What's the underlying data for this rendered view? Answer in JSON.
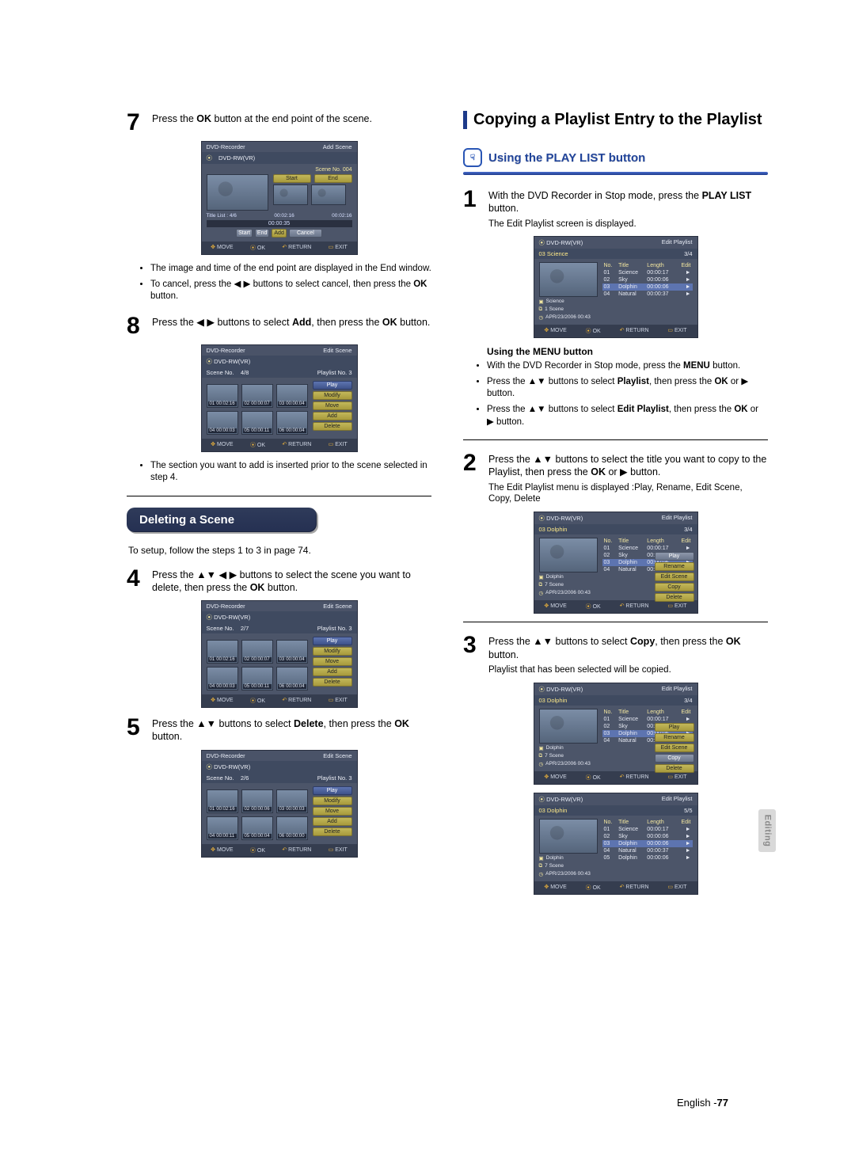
{
  "sideTab": "Editing",
  "footer": {
    "lang": "English -",
    "page": "77"
  },
  "left": {
    "step7": {
      "num": "7",
      "text_a": "Press the ",
      "text_b": "OK",
      "text_c": " button at the end point of the scene."
    },
    "step7_bullets": [
      "The image and time of the end point are displayed in the End window.",
      [
        "To cancel, press the ",
        "◀ ▶",
        " buttons to select cancel, then press the ",
        "OK",
        " button."
      ]
    ],
    "step8": {
      "num": "8",
      "parts": [
        "Press the ",
        "◀ ▶",
        " buttons to select ",
        "Add",
        ", then press the ",
        "OK",
        " button."
      ]
    },
    "step8_bullets": [
      "The section you want to add is inserted prior to the scene selected in step 4."
    ],
    "deleteTitle": "Deleting a Scene",
    "deleteIntro": "To setup, follow the steps 1 to 3 in page 74.",
    "step4": {
      "num": "4",
      "parts": [
        "Press the ",
        "▲▼ ◀ ▶",
        " buttons to select the scene you want to delete, then press the ",
        "OK",
        " button."
      ]
    },
    "step5": {
      "num": "5",
      "parts": [
        "Press the ",
        "▲▼",
        " buttons to select ",
        "Delete",
        ", then press the ",
        "OK",
        " button."
      ]
    }
  },
  "right": {
    "h1": "Copying a Playlist Entry to the Playlist",
    "h2": "Using the PLAY LIST button",
    "step1": {
      "num": "1",
      "parts": [
        "With the DVD Recorder in Stop mode, press the ",
        "PLAY LIST",
        " button."
      ],
      "small": "The Edit Playlist screen is displayed."
    },
    "menuTitle": "Using the MENU button",
    "menuBullets": [
      [
        "With the DVD Recorder in Stop mode, press the ",
        "MENU",
        " button."
      ],
      [
        "Press the ",
        "▲▼",
        " buttons to select ",
        "Playlist",
        ", then press the ",
        "OK",
        " or ",
        "▶",
        " button."
      ],
      [
        "Press the ",
        "▲▼",
        " buttons to select ",
        "Edit Playlist",
        ", then press the ",
        "OK",
        " or ",
        "▶",
        " button."
      ]
    ],
    "step2": {
      "num": "2",
      "parts": [
        "Press the ",
        "▲▼",
        " buttons to select the title you want to copy to the Playlist, then press the ",
        "OK",
        " or ",
        "▶",
        " button."
      ],
      "small": "The Edit Playlist menu is displayed :Play, Rename, Edit Scene, Copy, Delete"
    },
    "step3": {
      "num": "3",
      "parts": [
        "Press the ",
        "▲▼",
        " buttons to select ",
        "Copy",
        ", then press the ",
        "OK",
        " button."
      ],
      "small": "Playlist that has been selected will be copied."
    }
  },
  "osd": {
    "addScene": {
      "hdrL": "DVD-Recorder",
      "hdrR": "Add Scene",
      "disc": "DVD-RW(VR)",
      "sceneNo": "Scene No. 004",
      "startLbl": "Start",
      "endLbl": "End",
      "titleList": "Title List : 4/6",
      "t1": "00:02:16",
      "t2": "00:02:16",
      "length": "00:00:35",
      "btns": [
        "Start",
        "End",
        "Add",
        "Cancel"
      ],
      "foot": [
        "MOVE",
        "OK",
        "RETURN",
        "EXIT"
      ]
    },
    "editScene": {
      "hdrL": "DVD-Recorder",
      "hdrR": "Edit Scene",
      "disc": "DVD-RW(VR)",
      "foot": [
        "MOVE",
        "OK",
        "RETURN",
        "EXIT"
      ],
      "menu": [
        "Play",
        "Modify",
        "Move",
        "Add",
        "Delete"
      ]
    },
    "editSceneA": {
      "sceneNo": "Scene No.",
      "pg": "4/8",
      "pl": "Playlist No. 3",
      "cells": [
        [
          "01",
          "00:02:16"
        ],
        [
          "02",
          "00:00:07"
        ],
        [
          "03",
          "00:00:04"
        ],
        [
          "04",
          "00:00:03"
        ],
        [
          "05",
          "00:00:11"
        ],
        [
          "06",
          "00:00:04"
        ]
      ]
    },
    "editSceneB": {
      "sceneNo": "Scene No.",
      "pg": "2/7",
      "pl": "Playlist No. 3",
      "cells": [
        [
          "01",
          "00:02:16"
        ],
        [
          "02",
          "00:00:07"
        ],
        [
          "03",
          "00:00:04"
        ],
        [
          "04",
          "00:00:03"
        ],
        [
          "05",
          "00:00:11"
        ],
        [
          "06",
          "00:00:04"
        ]
      ]
    },
    "editSceneC": {
      "sceneNo": "Scene No.",
      "pg": "2/6",
      "pl": "Playlist No. 3",
      "cells": [
        [
          "01",
          "00:02:16"
        ],
        [
          "02",
          "00:00:06"
        ],
        [
          "03",
          "00:00:03"
        ],
        [
          "04",
          "00:00:11"
        ],
        [
          "05",
          "00:00:04"
        ],
        [
          "06",
          "00:00:00"
        ]
      ]
    },
    "editPlaylist": {
      "hdrL": "DVD-RW(VR)",
      "hdrR": "Edit Playlist",
      "foot": [
        "MOVE",
        "OK",
        "RETURN",
        "EXIT"
      ],
      "cols": [
        "No.",
        "Title",
        "Length",
        "Edit"
      ],
      "info": {
        "sceneLbl": "1 Scene",
        "scene7": "7 Scene",
        "date": "APR/23/2006 00:43"
      },
      "menu": [
        "Play",
        "Rename",
        "Edit Scene",
        "Copy",
        "Delete"
      ]
    },
    "pl1": {
      "name": "03 Science",
      "pg": "3/4",
      "rows": [
        [
          "01",
          "Science",
          "00:00:17",
          "►"
        ],
        [
          "02",
          "Sky",
          "00:00:06",
          "►"
        ],
        [
          "03",
          "Dolphin",
          "00:00:06",
          "►"
        ],
        [
          "04",
          "Natural",
          "00:00:37",
          "►"
        ]
      ],
      "infoTitle": "Science"
    },
    "pl2": {
      "name": "03 Dolphin",
      "pg": "3/4",
      "rows": [
        [
          "01",
          "Science",
          "00:00:17",
          "►"
        ],
        [
          "02",
          "Sky",
          "00:00:06",
          "►"
        ],
        [
          "03",
          "Dolphin",
          "00:00:06",
          "►"
        ],
        [
          "04",
          "Natural",
          "00:00:37",
          "►"
        ]
      ],
      "infoTitle": "Dolphin"
    },
    "pl3": {
      "name": "03 Dolphin",
      "pg": "3/4",
      "rows": [
        [
          "01",
          "Science",
          "00:00:17",
          "►"
        ],
        [
          "02",
          "Sky",
          "00:00:06",
          "►"
        ],
        [
          "03",
          "Dolphin",
          "00:00:06",
          "►"
        ],
        [
          "04",
          "Natural",
          "00:00:37",
          "►"
        ]
      ],
      "infoTitle": "Dolphin"
    },
    "pl4": {
      "name": "03 Dolphin",
      "pg": "5/5",
      "rows": [
        [
          "01",
          "Science",
          "00:00:17",
          "►"
        ],
        [
          "02",
          "Sky",
          "00:00:06",
          "►"
        ],
        [
          "03",
          "Dolphin",
          "00:00:06",
          "►"
        ],
        [
          "04",
          "Natural",
          "00:00:37",
          "►"
        ],
        [
          "05",
          "Dolphin",
          "00:00:06",
          "►"
        ]
      ],
      "infoTitle": "Dolphin"
    }
  }
}
